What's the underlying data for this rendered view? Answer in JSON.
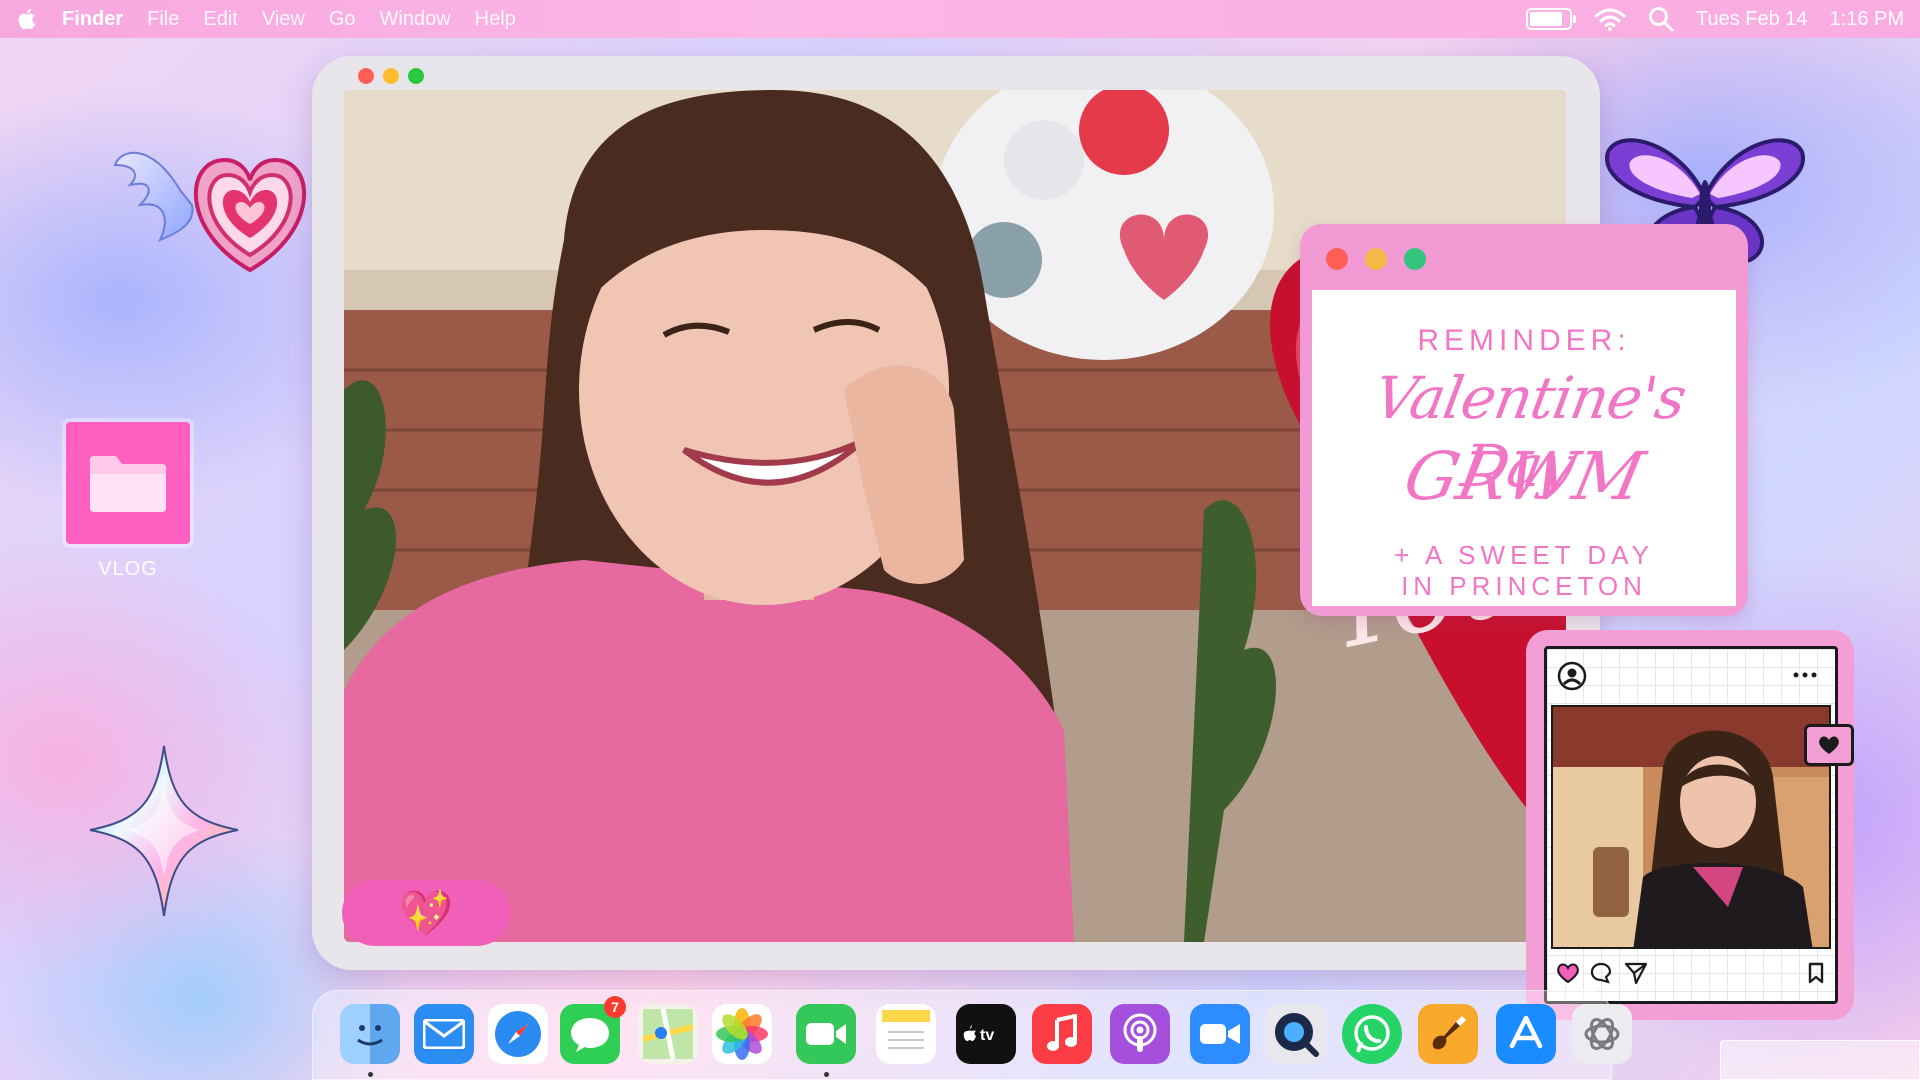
{
  "menubar": {
    "app_name": "Finder",
    "menus": [
      "File",
      "Edit",
      "View",
      "Go",
      "Window",
      "Help"
    ],
    "date": "Tues Feb 14",
    "time": "1:16 PM",
    "battery_level": 0.85
  },
  "desktop": {
    "folder_label": "VLOG",
    "icons": [
      "apple-icon",
      "battery-icon",
      "wifi-icon",
      "search-icon",
      "folder-icon",
      "winged-heart-sticker",
      "butterfly-sticker",
      "sparkle-star-sticker"
    ]
  },
  "video_window": {
    "emoji": "💖"
  },
  "reminder": {
    "kicker": "REMINDER:",
    "title_line1": "Valentine's Day",
    "title_line2": "GRWM",
    "subtitle_line1": "+ A SWEET DAY",
    "subtitle_line2": "IN PRINCETON"
  },
  "instagram": {
    "icons": [
      "profile-icon",
      "more-icon",
      "heart-icon",
      "comment-icon",
      "send-icon",
      "bookmark-icon",
      "heart-notification-icon"
    ]
  },
  "dock": {
    "messages_badge": "7",
    "apps": [
      "Finder",
      "Mail",
      "Safari",
      "Messages",
      "Maps",
      "Photos",
      "FaceTime",
      "Notes",
      "Apple TV",
      "Music",
      "Podcasts",
      "Zoom",
      "QuickTime Player",
      "WhatsApp",
      "GarageBand",
      "App Store",
      "ChatGPT"
    ]
  },
  "colors": {
    "menubar_pink": "#f9ace1",
    "accent_pink": "#f276c6",
    "pill_pink": "#f05fb8",
    "folder_pink": "#ff5fbf",
    "traffic_red": "#ff5f57",
    "traffic_yellow": "#febc2e",
    "traffic_green": "#28c840"
  }
}
